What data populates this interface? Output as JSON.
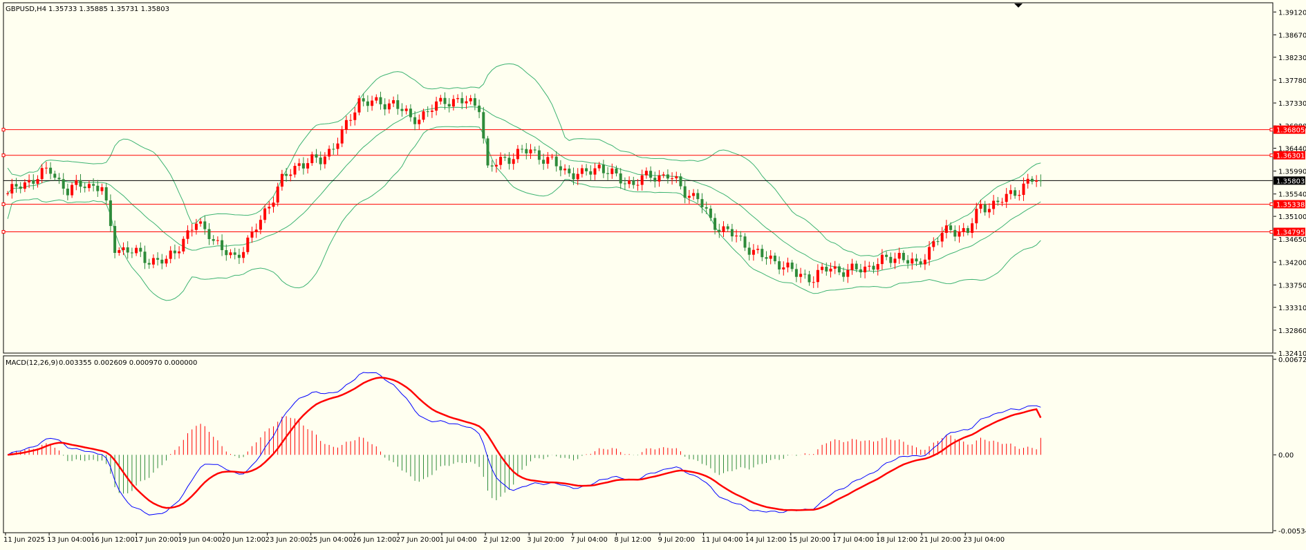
{
  "window": {
    "title": "GBPUSD,H4",
    "ohlc": "1.35733 1.35885 1.35731 1.35803"
  },
  "macd_panel": {
    "title": "MACD(12,26,9)",
    "values": "0.003355 0.002609 0.000970 0.000000"
  },
  "colors": {
    "background": "#fffff0",
    "bull": "#2e8b3a",
    "bear": "#ff0000",
    "bands": "#3cb371",
    "level_line": "#ff0000",
    "current_price_line": "#000000",
    "macd_main": "#0000ff",
    "macd_signal": "#ff0000",
    "macd_hist_positive": "#ff0000",
    "macd_hist_negative": "#2e8b3a"
  },
  "chart_data": [
    {
      "type": "candlestick",
      "symbol": "GBPUSD",
      "timeframe": "H4",
      "y_ticks": [
        "1.39120",
        "1.38670",
        "1.38230",
        "1.37780",
        "1.37330",
        "1.36880",
        "1.36440",
        "1.35990",
        "1.35540",
        "1.35100",
        "1.34650",
        "1.34200",
        "1.33750",
        "1.33310",
        "1.32860",
        "1.32410"
      ],
      "ylim": [
        1.3241,
        1.3922
      ],
      "x_ticks": [
        "11 Jun 2025",
        "13 Jun 04:00",
        "16 Jun 12:00",
        "17 Jun 20:00",
        "19 Jun 04:00",
        "20 Jun 12:00",
        "23 Jun 20:00",
        "25 Jun 04:00",
        "26 Jun 12:00",
        "27 Jun 20:00",
        "1 Jul 04:00",
        "2 Jul 12:00",
        "3 Jul 20:00",
        "7 Jul 04:00",
        "8 Jul 12:00",
        "9 Jul 20:00",
        "11 Jul 04:00",
        "14 Jul 12:00",
        "15 Jul 20:00",
        "17 Jul 04:00",
        "18 Jul 12:00",
        "21 Jul 20:00",
        "23 Jul 04:00"
      ],
      "current_price": "1.35803",
      "horizontal_levels": [
        "1.36805",
        "1.36301",
        "1.35338",
        "1.34795"
      ],
      "indicators": [
        "Bollinger Bands"
      ],
      "grid": false
    },
    {
      "type": "line",
      "name": "MACD(12,26,9)",
      "y_ticks": [
        "0.006727",
        "0.00",
        "-0.005342"
      ],
      "ylim": [
        -0.005342,
        0.006727
      ],
      "series": [
        {
          "values": [
            0.003355
          ]
        },
        {
          "values": [
            0.002609
          ]
        }
      ],
      "histogram": [
        0.00097
      ]
    }
  ]
}
